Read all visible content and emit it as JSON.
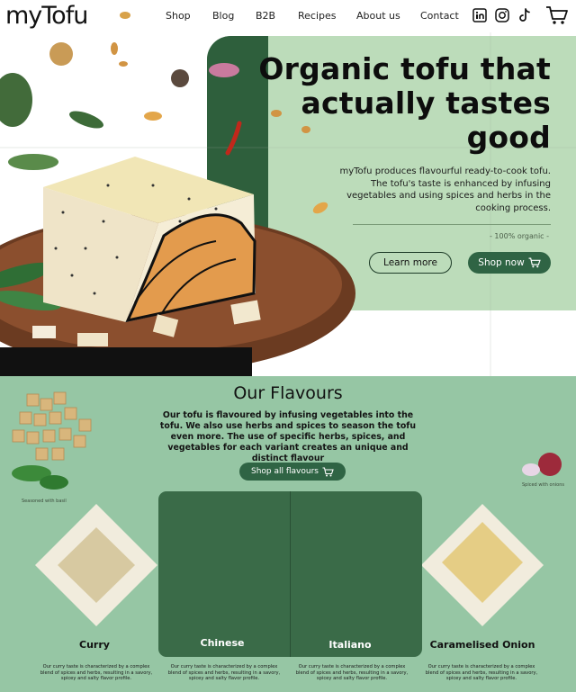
{
  "brand": {
    "logo_text": "myTofu"
  },
  "nav": {
    "links": [
      "Shop",
      "Blog",
      "B2B",
      "Recipes",
      "About us",
      "Contact"
    ],
    "social": [
      "linkedin-icon",
      "instagram-icon",
      "tiktok-icon"
    ],
    "cart_icon": "cart-icon"
  },
  "hero": {
    "title": "Organic tofu that actually tastes good",
    "description": "myTofu produces flavourful ready-to-cook tofu. The tofu's taste is enhanced by infusing vegetables and using spices and herbs in the cooking process.",
    "tag": "- 100% organic -",
    "learn_more": "Learn more",
    "shop_now": "Shop now"
  },
  "flavours": {
    "title": "Our Flavours",
    "description": "Our tofu is flavoured by infusing vegetables into the tofu. We also use herbs and spices to season the tofu even more. The use of specific herbs, spices, and vegetables for each variant creates an unique and distinct flavour",
    "shop_all": "Shop all flavours",
    "left_caption": "Seasoned with basil",
    "right_caption": "Spiced with onions",
    "items": [
      {
        "name": "Curry",
        "text": "Our curry taste is characterized by a complex blend of spices and herbs, resulting in a savory, spicey and salty flavor profile."
      },
      {
        "name": "Chinese",
        "text": "Our curry taste is characterized by a complex blend of spices and herbs, resulting in a savory, spicey and salty flavor profile."
      },
      {
        "name": "Italiano",
        "text": "Our curry taste is characterized by a complex blend of spices and herbs, resulting in a savory, spicey and salty flavor profile."
      },
      {
        "name": "Caramelised Onion",
        "text": "Our curry taste is characterized by a complex blend of spices and herbs, resulting in a savory, spicey and salty flavor profile."
      }
    ]
  },
  "colors": {
    "accent_green": "#2f6444",
    "hero_panel": "#bcdcba",
    "section_bg": "#93c4a3"
  }
}
